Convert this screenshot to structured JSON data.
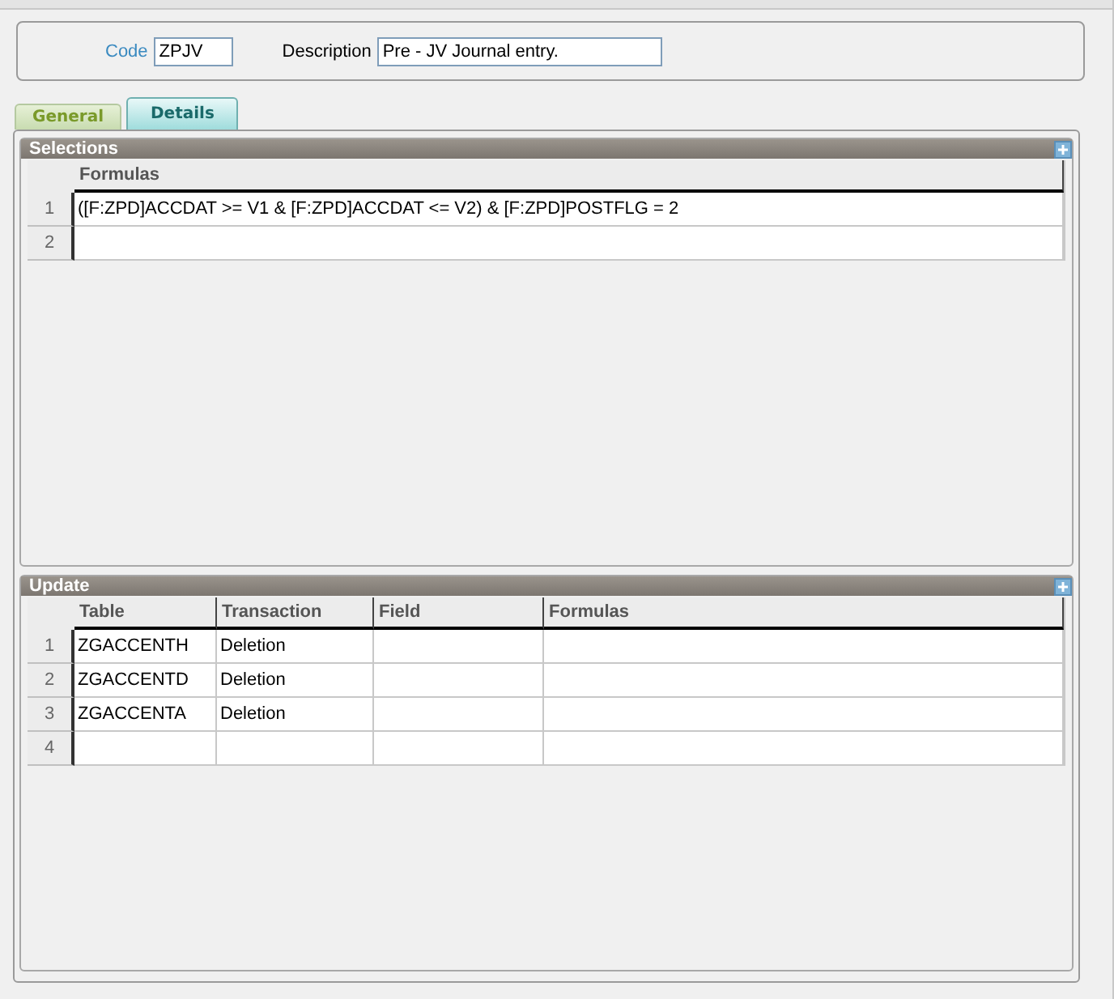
{
  "header": {
    "code": {
      "label": "Code",
      "value": "ZPJV"
    },
    "description": {
      "label": "Description",
      "value": "Pre - JV Journal entry."
    }
  },
  "tabs": [
    {
      "label": "General",
      "selected": false
    },
    {
      "label": "Details",
      "selected": true
    }
  ],
  "selections": {
    "title": "Selections",
    "columns": [
      "Formulas"
    ],
    "rows": [
      {
        "number": "1",
        "cells": [
          "([F:ZPD]ACCDAT >= V1  & [F:ZPD]ACCDAT <= V2)  & [F:ZPD]POSTFLG = 2"
        ]
      },
      {
        "number": "2",
        "cells": [
          ""
        ]
      }
    ]
  },
  "update": {
    "title": "Update",
    "columns": [
      "Table",
      "Transaction",
      "Field",
      "Formulas"
    ],
    "rows": [
      {
        "number": "1",
        "cells": [
          "ZGACCENTH",
          "Deletion",
          "",
          ""
        ]
      },
      {
        "number": "2",
        "cells": [
          "ZGACCENTD",
          "Deletion",
          "",
          ""
        ]
      },
      {
        "number": "3",
        "cells": [
          "ZGACCENTA",
          "Deletion",
          "",
          ""
        ]
      },
      {
        "number": "4",
        "cells": [
          "",
          "",
          "",
          ""
        ]
      }
    ]
  }
}
